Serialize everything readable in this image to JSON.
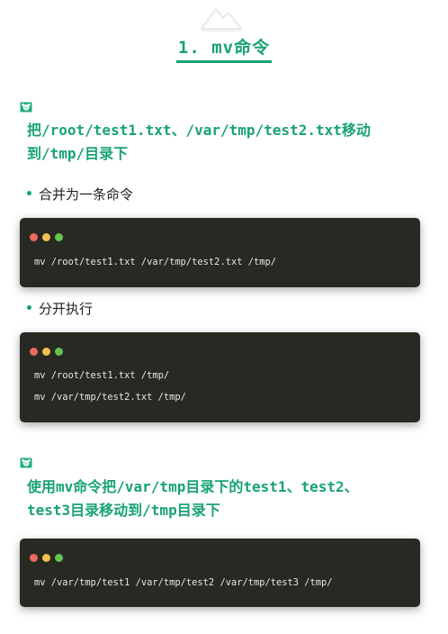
{
  "section": {
    "title": "1. mv命令"
  },
  "icons": {
    "watermark": "mountain-logo-icon",
    "question": "face-icon"
  },
  "colors": {
    "accent": "#19a275",
    "code_bg": "#282922",
    "dot_red": "#ec6a5e",
    "dot_yellow": "#f4bf4f",
    "dot_green": "#61c554"
  },
  "q1": {
    "title_line1": "把/root/test1.txt、/var/tmp/test2.txt移动",
    "title_line2": "到/tmp/目录下",
    "bullet1": "合并为一条命令",
    "code1": [
      "mv /root/test1.txt /var/tmp/test2.txt /tmp/"
    ],
    "bullet2": "分开执行",
    "code2": [
      "mv /root/test1.txt /tmp/",
      "mv /var/tmp/test2.txt /tmp/"
    ]
  },
  "q2": {
    "title_line1": "使用mv命令把/var/tmp目录下的test1、test2、",
    "title_line2": "test3目录移动到/tmp目录下",
    "code1": [
      "mv /var/tmp/test1 /var/tmp/test2 /var/tmp/test3 /tmp/"
    ]
  }
}
